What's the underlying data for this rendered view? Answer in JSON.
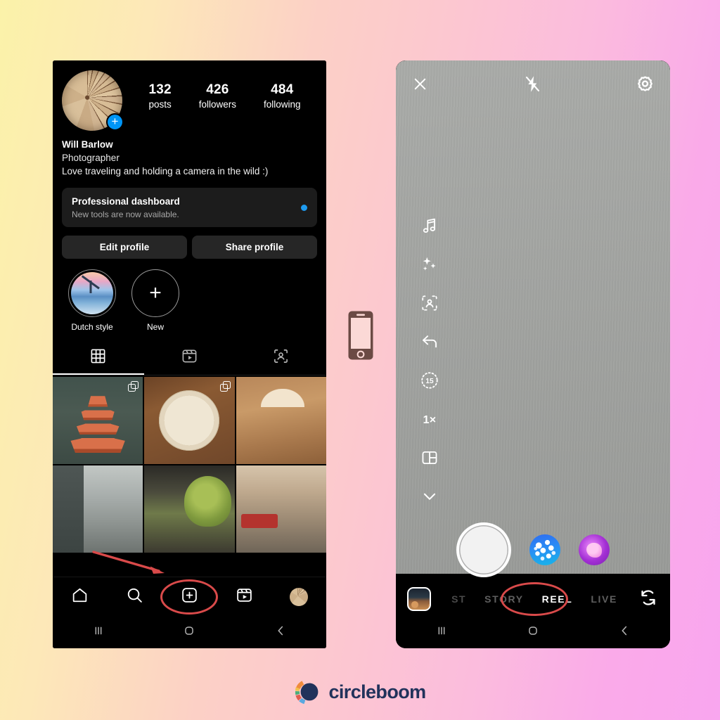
{
  "background": {
    "from_color": "#fbf2a9",
    "to_color": "#f9a6ef"
  },
  "brand": {
    "name": "circleboom",
    "logo_icon": "circleboom-logo-icon",
    "text_color": "#21325b"
  },
  "decor": {
    "phone_glyph_icon": "phone-glyph-icon",
    "arrow_icon": "annotation-arrow-icon",
    "highlight_color": "#d94a4a"
  },
  "instagram_profile": {
    "avatar": {
      "icon": "profile-avatar",
      "badge_icon": "add-story-plus-badge"
    },
    "stats": [
      {
        "value": "132",
        "label": "posts"
      },
      {
        "value": "426",
        "label": "followers"
      },
      {
        "value": "484",
        "label": "following"
      }
    ],
    "bio": {
      "name": "Will Barlow",
      "category": "Photographer",
      "description": "Love traveling and holding a camera in the wild :)"
    },
    "dashboard": {
      "title": "Professional dashboard",
      "subtitle": "New tools are now available.",
      "dot_color": "#1e9bf0"
    },
    "buttons": {
      "edit": "Edit profile",
      "share": "Share profile"
    },
    "highlights": [
      {
        "label": "Dutch style",
        "icon": "highlight-cover-dutch-style"
      },
      {
        "label": "New",
        "icon": "add-highlight-plus-icon"
      }
    ],
    "tabs": [
      {
        "name": "grid",
        "icon": "grid-tab-icon",
        "active": true
      },
      {
        "name": "reels",
        "icon": "reels-tab-icon",
        "active": false
      },
      {
        "name": "tagged",
        "icon": "tagged-tab-icon",
        "active": false
      }
    ],
    "posts": [
      {
        "name": "pagoda-temple-photo",
        "carousel": true
      },
      {
        "name": "sushi-plate-photo",
        "carousel": true
      },
      {
        "name": "street-cafe-photo",
        "carousel": false
      },
      {
        "name": "city-street-photo",
        "carousel": false
      },
      {
        "name": "tree-lined-street-photo",
        "carousel": false
      },
      {
        "name": "city-avenue-photo",
        "carousel": false
      }
    ],
    "bottom_nav": [
      {
        "name": "home",
        "icon": "home-icon"
      },
      {
        "name": "search",
        "icon": "search-icon"
      },
      {
        "name": "create",
        "icon": "plus-square-icon",
        "highlighted": true
      },
      {
        "name": "reels",
        "icon": "reels-icon"
      },
      {
        "name": "profile",
        "icon": "profile-avatar-icon"
      }
    ],
    "system_nav": [
      {
        "name": "recents",
        "icon": "recents-icon"
      },
      {
        "name": "home",
        "icon": "home-circle-icon"
      },
      {
        "name": "back",
        "icon": "back-chevron-icon"
      }
    ]
  },
  "instagram_camera": {
    "top_bar": [
      {
        "name": "close",
        "icon": "close-x-icon"
      },
      {
        "name": "flash",
        "icon": "flash-off-icon"
      },
      {
        "name": "settings",
        "icon": "gear-icon"
      }
    ],
    "tool_rail": [
      {
        "name": "audio",
        "icon": "music-note-icon"
      },
      {
        "name": "effects",
        "icon": "sparkles-icon"
      },
      {
        "name": "green-screen",
        "icon": "green-screen-icon"
      },
      {
        "name": "align",
        "icon": "align-undo-arrow-icon"
      },
      {
        "name": "timer",
        "icon": "timer-icon",
        "label": "15"
      },
      {
        "name": "speed",
        "icon": "speed-icon",
        "label": "1×"
      },
      {
        "name": "layout",
        "icon": "layout-icon"
      },
      {
        "name": "more",
        "icon": "chevron-down-icon"
      }
    ],
    "capture": {
      "shutter_icon": "shutter-button",
      "effects": [
        {
          "name": "sparkle-effect",
          "icon": "blue-sparkle-effect-thumb"
        },
        {
          "name": "gem-effect",
          "icon": "purple-gem-effect-thumb"
        }
      ]
    },
    "mode_bar": {
      "gallery_icon": "gallery-thumbnail",
      "modes": [
        {
          "label": "ST",
          "active": false,
          "truncated": true
        },
        {
          "label": "STORY",
          "active": false
        },
        {
          "label": "REEL",
          "active": true,
          "highlighted": true
        },
        {
          "label": "LIVE",
          "active": false
        }
      ],
      "flip_icon": "flip-camera-icon"
    },
    "system_nav": [
      {
        "name": "recents",
        "icon": "recents-icon"
      },
      {
        "name": "home",
        "icon": "home-circle-icon"
      },
      {
        "name": "back",
        "icon": "back-chevron-icon"
      }
    ]
  }
}
